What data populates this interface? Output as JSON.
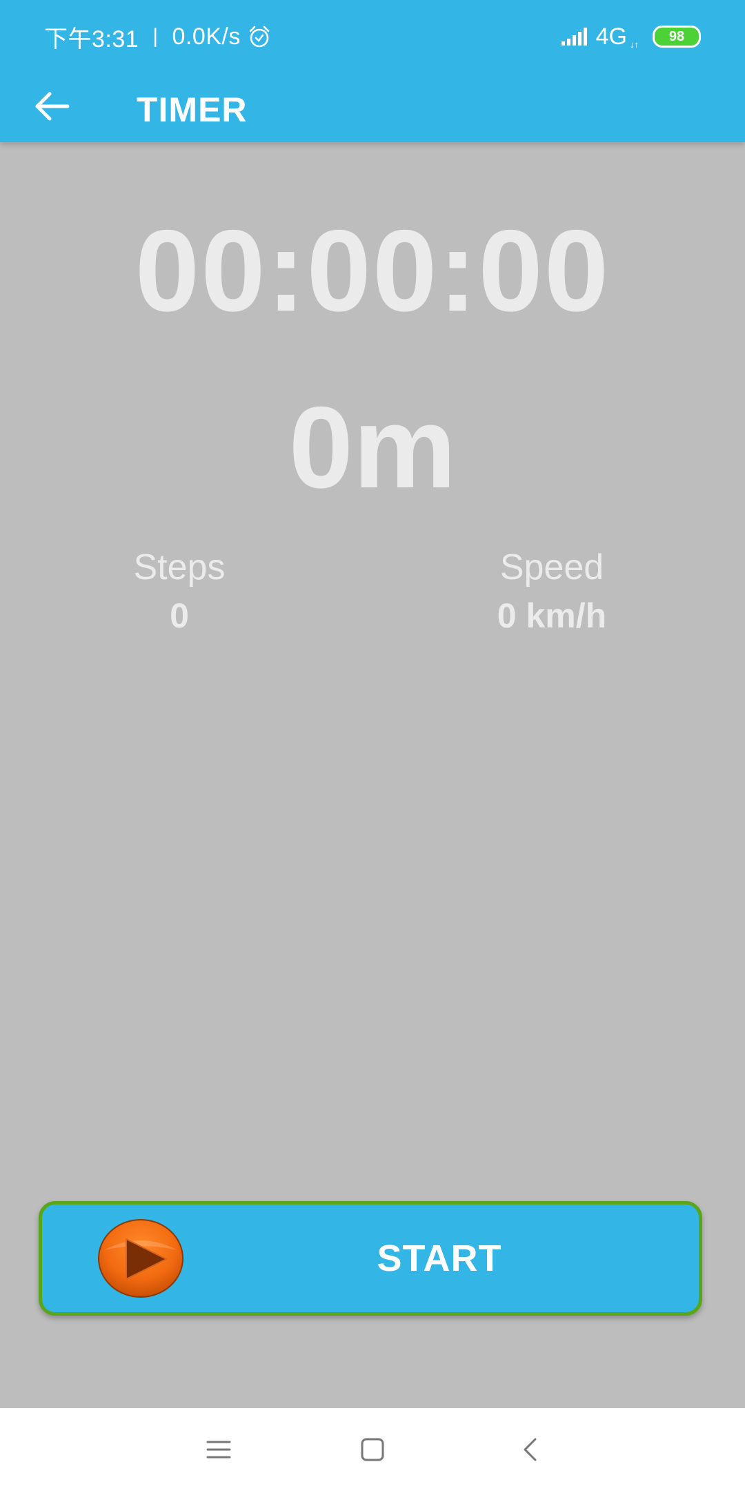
{
  "status_bar": {
    "time": "下午3:31",
    "separator": "|",
    "network_speed": "0.0K/s",
    "network_type": "4G",
    "network_arrows": "↓↑",
    "battery_level": "98",
    "icons": [
      "alarm-icon",
      "signal-icon",
      "battery-icon"
    ]
  },
  "toolbar": {
    "title": "TIMER",
    "back_icon": "arrow-left-icon"
  },
  "timer": {
    "elapsed": "00:00:00",
    "distance": "0m"
  },
  "stats": {
    "steps_label": "Steps",
    "steps_value": "0",
    "speed_label": "Speed",
    "speed_value": "0 km/h"
  },
  "start_button": {
    "label": "START",
    "icon": "play-icon"
  },
  "nav_bar": {
    "icons": [
      "menu-icon",
      "home-icon",
      "back-icon"
    ]
  },
  "colors": {
    "app_bar": "#33b5e5",
    "background": "#bdbdbd",
    "text_light": "#ebebeb",
    "button_border": "#5aa61b",
    "play_orange": "#f26a10",
    "battery_green": "#4cd137"
  }
}
